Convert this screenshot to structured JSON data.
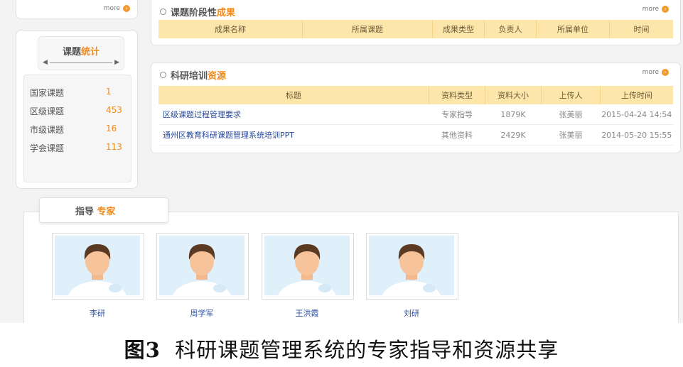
{
  "more_label": "more",
  "stats": {
    "title_a": "课题",
    "title_b": "统计",
    "rows": [
      {
        "label": "国家课题",
        "value": "1"
      },
      {
        "label": "区级课题",
        "value": "453"
      },
      {
        "label": "市级课题",
        "value": "16"
      },
      {
        "label": "学会课题",
        "value": "113"
      }
    ]
  },
  "stage_results": {
    "title_a": "课题阶段性",
    "title_b": "成果",
    "columns": [
      "成果名称",
      "所属课题",
      "成果类型",
      "负责人",
      "所属单位",
      "时间"
    ]
  },
  "resources": {
    "title_a": "科研培训",
    "title_b": "资源",
    "columns": [
      "标题",
      "资料类型",
      "资料大小",
      "上传人",
      "上传时间"
    ],
    "rows": [
      {
        "title": "区级课题过程管理要求",
        "type": "专家指导",
        "size": "1879K",
        "uploader": "张美丽",
        "time": "2015-04-24 14:54"
      },
      {
        "title": "通州区教育科研课题管理系统培训PPT",
        "type": "其他资料",
        "size": "2429K",
        "uploader": "张美丽",
        "time": "2014-05-20 15:55"
      }
    ]
  },
  "experts": {
    "title_a": "指导",
    "title_b": "专家",
    "names": [
      "李研",
      "周学军",
      "王洪霞",
      "刘研"
    ]
  },
  "caption": {
    "fig": "图3",
    "text": "科研课题管理系统的专家指导和资源共享"
  },
  "colors": {
    "accent": "#f08a1c",
    "table_header": "#fde6a9",
    "link": "#274a9e"
  }
}
